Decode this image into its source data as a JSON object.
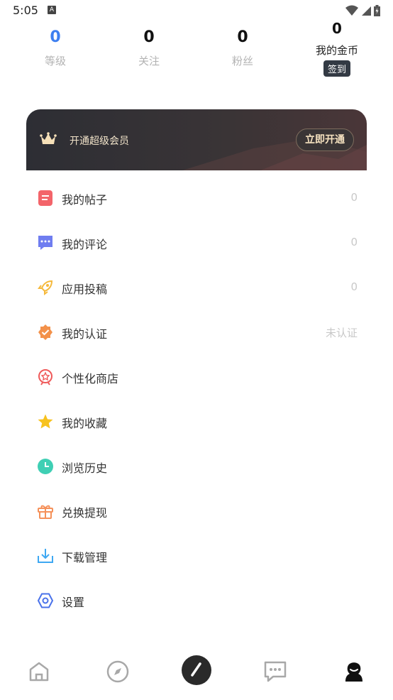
{
  "status_bar": {
    "time": "5:05",
    "notification_letter": "A"
  },
  "stats": [
    {
      "value": "0",
      "label": "等级"
    },
    {
      "value": "0",
      "label": "关注"
    },
    {
      "value": "0",
      "label": "粉丝"
    },
    {
      "value": "0",
      "label": "我的金币",
      "action": "签到"
    }
  ],
  "vip_banner": {
    "text": "开通超级会员",
    "button": "立即开通"
  },
  "menu": [
    {
      "label": "我的帖子",
      "value": "0",
      "icon": "post-icon",
      "color": "#f3646a"
    },
    {
      "label": "我的评论",
      "value": "0",
      "icon": "comment-icon",
      "color": "#6f7df0"
    },
    {
      "label": "应用投稿",
      "value": "0",
      "icon": "rocket-icon",
      "color": "#f5b93c"
    },
    {
      "label": "我的认证",
      "value": "未认证",
      "icon": "verified-badge-icon",
      "color": "#f3914a"
    },
    {
      "label": "个性化商店",
      "value": "",
      "icon": "store-badge-icon",
      "color": "#ef5a5a"
    },
    {
      "label": "我的收藏",
      "value": "",
      "icon": "star-icon",
      "color": "#f7c21e"
    },
    {
      "label": "浏览历史",
      "value": "",
      "icon": "clock-icon",
      "color": "#3fcfb4"
    },
    {
      "label": "兑换提现",
      "value": "",
      "icon": "gift-icon",
      "color": "#f5915a"
    },
    {
      "label": "下载管理",
      "value": "",
      "icon": "download-icon",
      "color": "#3ea8f2"
    },
    {
      "label": "设置",
      "value": "",
      "icon": "settings-hexagon-icon",
      "color": "#4a72ea"
    }
  ],
  "tabbar": [
    {
      "name": "home-icon"
    },
    {
      "name": "compass-icon"
    },
    {
      "name": "compose-icon"
    },
    {
      "name": "messages-icon"
    },
    {
      "name": "profile-icon"
    }
  ]
}
